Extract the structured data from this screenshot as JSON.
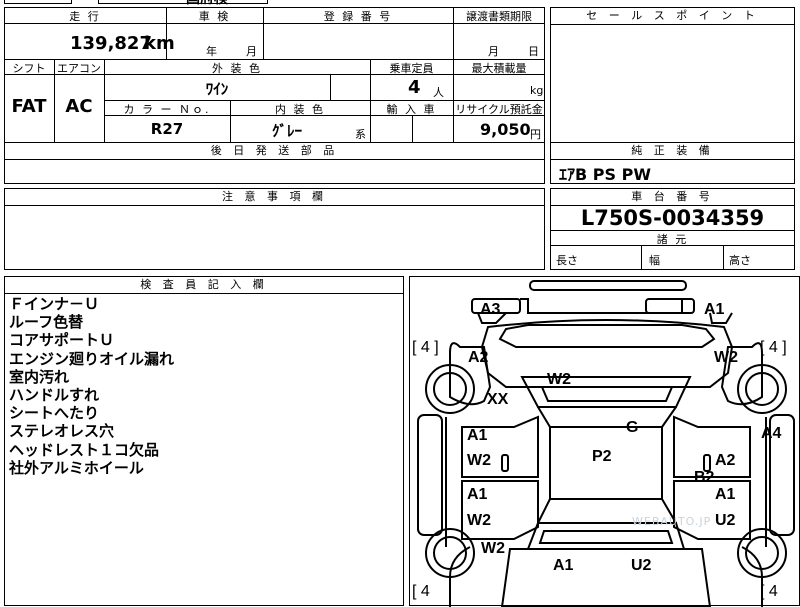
{
  "top_partial": "国府検",
  "mileage": {
    "label": "走 行",
    "value": "139,827",
    "unit": "km"
  },
  "inspection": {
    "label": "車 検",
    "year_unit": "年",
    "month_unit": "月"
  },
  "registration": {
    "label": "登 録 番 号"
  },
  "transfer_deadline": {
    "label": "譲渡書類期限",
    "month_unit": "月",
    "day_unit": "日"
  },
  "sales_point": {
    "label": "セ ー ル ス ポ イ ン ト"
  },
  "shift": {
    "label": "シフト",
    "value": "FAT"
  },
  "aircon": {
    "label": "エアコン",
    "value": "AC"
  },
  "exterior_color": {
    "label": "外 装 色",
    "value": "ﾜｲﾝ"
  },
  "capacity": {
    "label": "乗車定員",
    "value": "4",
    "unit": "人"
  },
  "max_load": {
    "label": "最大積載量",
    "unit": "kg"
  },
  "color_no": {
    "label": "カ ラ ー Ｎｏ.",
    "value": "R27"
  },
  "interior_color": {
    "label": "内 装 色",
    "value": "ｸﾞﾚｰ",
    "suffix": "系"
  },
  "import_car": {
    "label": "輸 入 車"
  },
  "recycle_fee": {
    "label": "リサイクル預託金",
    "value": "9,050",
    "unit": "円"
  },
  "later_parts": {
    "label": "後 日 発 送 部 品"
  },
  "genuine_equipment": {
    "label": "純 正 装 備",
    "value": "ｴｱB PS PW"
  },
  "caution": {
    "label": "注 意 事 項 欄"
  },
  "chassis_no": {
    "label": "車 台 番 号",
    "value": "L750S-0034359"
  },
  "dimensions": {
    "label": "諸 元",
    "length": "長さ",
    "width": "幅",
    "height": "高さ"
  },
  "inspector_notes": {
    "label": "検 査 員 記 入 欄",
    "lines": [
      "Ｆインナ－Ｕ",
      "ルーフ色替",
      "コアサポートＵ",
      "エンジン廻りオイル漏れ",
      "室内汚れ",
      "ハンドルすれ",
      "シートへたり",
      "ステレオレス穴",
      "ヘッドレスト１コ欠品",
      "社外アルミホイール"
    ]
  },
  "damage_map": {
    "tire_fl": "[ 4 ]",
    "tire_fr": "[ 4 ]",
    "tire_rl": "[ 4",
    "tire_rr": "[ 4",
    "marks": {
      "a3": "A3",
      "a1_front_right": "A1",
      "a2_left_fender": "A2",
      "w2_right_fender": "W2",
      "w2_hood": "W2",
      "xx": "XX",
      "g": "G",
      "a4": "A4",
      "a1_left_front_door": "A1",
      "w2_left_front_door": "W2",
      "p2_roof": "P2",
      "a2_right_front_door": "A2",
      "b2_right_pillar": "B2",
      "a1_left_rear_door": "A1",
      "w2_left_rear_door": "W2",
      "a1_right_rear_door": "A1",
      "u2_right_rear_door": "U2",
      "w2_left_rear_fender": "W2",
      "a1_rear": "A1",
      "u2_rear": "U2"
    }
  },
  "watermark": "WEBAUTO.JP"
}
